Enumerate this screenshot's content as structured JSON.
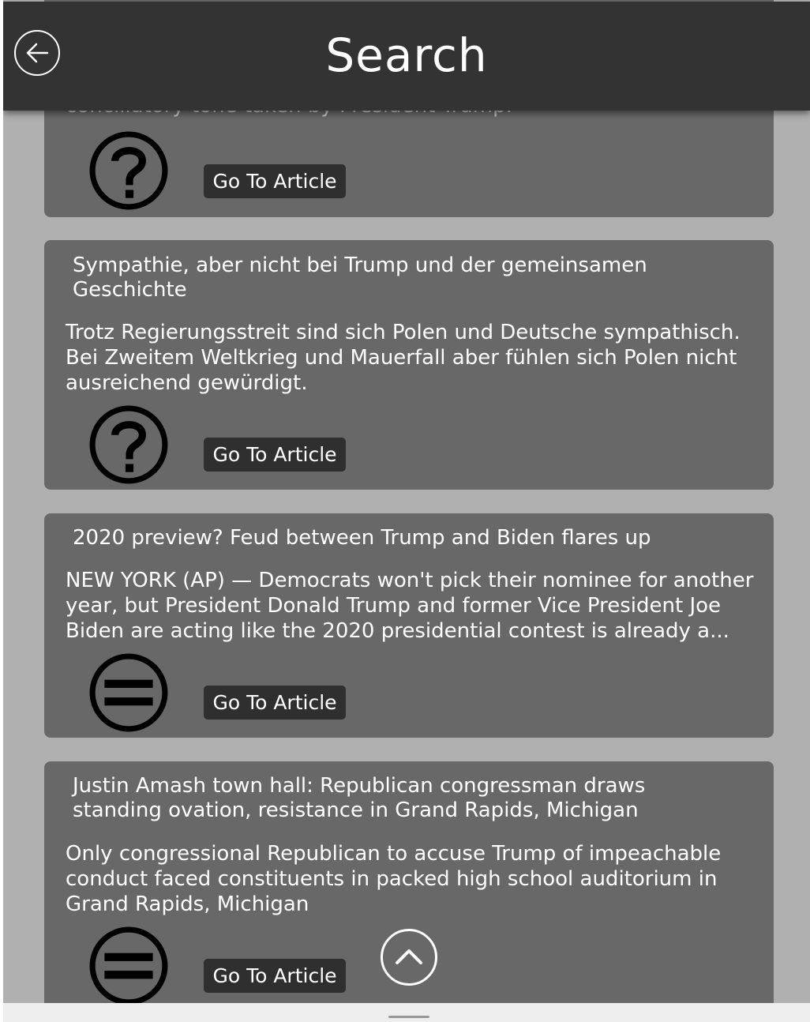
{
  "header": {
    "title": "Search",
    "back_icon": "arrow-left-icon"
  },
  "articles": [
    {
      "title": "",
      "description": "conciliatory tone taken by President Trump.",
      "icon": "question-mark-icon",
      "button_label": "Go To Article"
    },
    {
      "title": "Sympathie, aber nicht bei Trump und der gemeinsamen Geschichte",
      "description": "Trotz Regierungsstreit sind sich Polen und Deutsche sympathisch. Bei Zweitem Weltkrieg und Mauerfall aber fühlen sich Polen nicht ausreichend gewürdigt.",
      "icon": "question-mark-icon",
      "button_label": "Go To Article"
    },
    {
      "title": "2020 preview? Feud between Trump and Biden flares up",
      "description": "NEW YORK (AP) — Democrats won't pick their nominee for another year, but President Donald Trump and former Vice President Joe Biden are acting like the 2020 presidential contest is already a...",
      "icon": "equals-neutral-icon",
      "button_label": "Go To Article"
    },
    {
      "title": "Justin Amash town hall: Republican congressman draws standing ovation, resistance in Grand Rapids, Michigan",
      "description": "Only congressional Republican to accuse Trump of impeachable conduct faced constituents in packed high school auditorium in Grand Rapids, Michigan",
      "icon": "equals-neutral-icon",
      "button_label": "Go To Article"
    }
  ],
  "scroll_top_icon": "chevron-up-icon",
  "colors": {
    "header_bg": "#333333",
    "card_bg": "#686868",
    "page_bg": "#b0b0b0",
    "button_bg": "#2f2f2f"
  }
}
